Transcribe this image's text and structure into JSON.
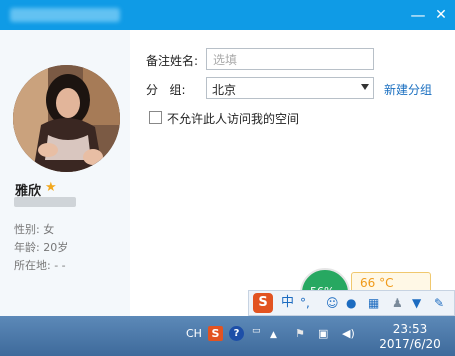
{
  "window": {
    "minimize_glyph": "—",
    "close_glyph": "✕"
  },
  "profile": {
    "nickname": "雅欣",
    "star_icon": "star-icon",
    "gender": "性别: 女",
    "age": "年龄: 20岁",
    "location": "所在地: -  -"
  },
  "form": {
    "remark_label": "备注姓名:",
    "remark_placeholder": "选填",
    "group_label": "分   组:",
    "group_value": "北京",
    "new_group_link": "新建分组",
    "privacy_label": "不允许此人访问我的空间",
    "privacy_checked": false
  },
  "widget": {
    "percent": "56%",
    "temperature": "66 °C"
  },
  "ime": {
    "logo": "S",
    "mode": "中",
    "punct": "°,",
    "items": [
      "smile-icon",
      "mic-icon",
      "keyboard-icon",
      "user-icon",
      "shirt-icon",
      "wrench-icon"
    ]
  },
  "taskbar": {
    "lang": "CH",
    "sogou": "S",
    "help": "?",
    "time": "23:53",
    "date": "2017/6/20"
  },
  "colors": {
    "titlebar": "#0f9be6",
    "link": "#1a6fc0",
    "widget_green": "#27a861",
    "temp_orange": "#f09a1a"
  }
}
